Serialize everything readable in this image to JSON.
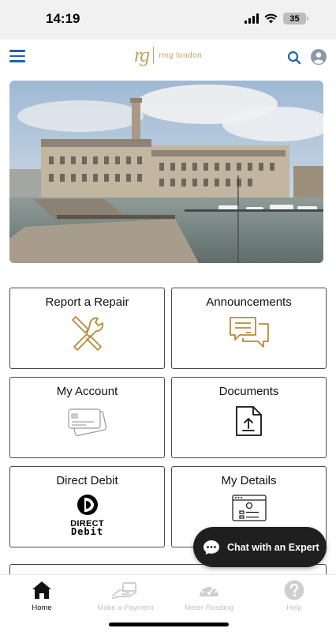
{
  "status_bar": {
    "time": "14:19",
    "battery": "35"
  },
  "header": {
    "logo_mark": "rg",
    "logo_text": "rmg london",
    "icons": [
      "menu-icon",
      "search-icon",
      "account-icon"
    ],
    "accent_color": "#1f63a8",
    "brand_color": "#c3a265"
  },
  "hero": {
    "subject": "harbour-building-photo"
  },
  "tiles": [
    {
      "label": "Report a Repair",
      "icon": "tools-icon"
    },
    {
      "label": "Announcements",
      "icon": "chat-bubbles-icon"
    },
    {
      "label": "My Account",
      "icon": "cards-icon"
    },
    {
      "label": "Documents",
      "icon": "document-upload-icon"
    },
    {
      "label": "Direct Debit",
      "icon": "direct-debit-logo",
      "logo_text_1": "DIRECT",
      "logo_text_2": "Debit"
    },
    {
      "label": "My Details",
      "icon": "profile-window-icon"
    }
  ],
  "chat": {
    "label": "Chat with an Expert"
  },
  "tab_bar": {
    "items": [
      {
        "label": "Home",
        "icon": "home-icon",
        "active": true
      },
      {
        "label": "Make a Payment",
        "icon": "payment-hand-icon",
        "active": false
      },
      {
        "label": "Meter Reading",
        "icon": "gauge-icon",
        "active": false
      },
      {
        "label": "Help",
        "icon": "help-icon",
        "active": false
      }
    ]
  }
}
